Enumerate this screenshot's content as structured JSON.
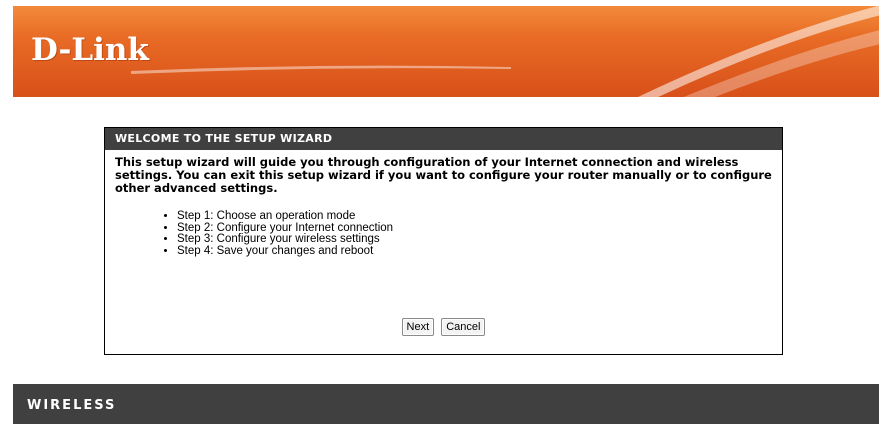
{
  "header": {
    "brand": "D-Link",
    "colors": {
      "banner_top": "#f28a3a",
      "banner_bottom": "#d8501a"
    }
  },
  "wizard": {
    "title": "WELCOME TO THE SETUP WIZARD",
    "intro": "This setup wizard will guide you through configuration of your Internet connection and wireless settings. You can exit this setup wizard if you want to configure your router manually or to configure other advanced settings.",
    "steps": [
      "Step 1: Choose an operation mode",
      "Step 2: Configure your Internet connection",
      "Step 3: Configure your wireless settings",
      "Step 4: Save your changes and reboot"
    ],
    "next_label": "Next",
    "cancel_label": "Cancel",
    "colors": {
      "title_bar": "#404040"
    }
  },
  "footer": {
    "label": "WIRELESS",
    "colors": {
      "bar": "#404040"
    }
  }
}
